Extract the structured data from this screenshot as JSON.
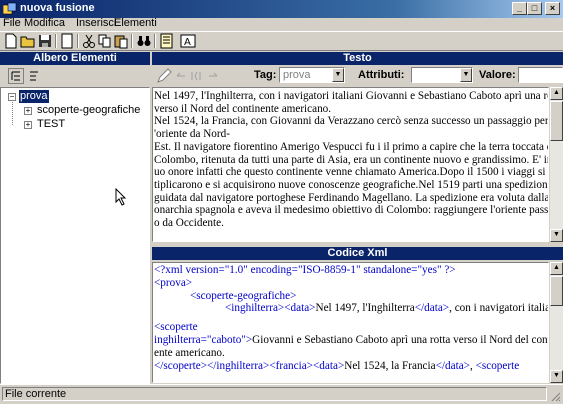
{
  "window": {
    "title": "nuova fusione"
  },
  "menu": [
    "File",
    "Modifica",
    "Inserisci",
    "Elementi"
  ],
  "left_pane": {
    "header": "Albero Elementi",
    "tree": {
      "root": "prova",
      "children": [
        "scoperte-geografiche",
        "TEST"
      ]
    }
  },
  "testo_pane": {
    "header": "Testo",
    "tag_label": "Tag:",
    "tag_value": "prova",
    "attr_label": "Attributi:",
    "value_label": "Valore:",
    "lines": [
      "Nel 1497, l'Inghilterra, con i navigatori italiani Giovanni e Sebastiano Caboto aprì una rotta",
      " verso il Nord del continente americano.",
      "Nel 1524, la Francia, con Giovanni da Verazzano cercò senza successo un passaggio per l",
      "'oriente da Nord-",
      "Est. Il navigatore fiorentino Amerigo Vespucci fu i il primo a capire che la terra toccata da",
      "Colombo, ritenuta da tutti una parte di Asia, era un continente nuovo e grandissimo. E' in s",
      "uo onore infatti che questo continente venne chiamato America.Dopo il 1500 i viaggi si mol",
      "tiplicarono e si acquisirono nuove conoscenze geografiche.Nel 1519  parti una spedizione",
      "guidata dal navigatore portoghese Ferdinando Magellano. La spedizione era voluta dalla m",
      "onarchia spagnola e aveva il medesimo obiettivo di Colombo: raggiungere l'oriente passand",
      "o da Occidente."
    ]
  },
  "xml_pane": {
    "header": "Codice Xml",
    "l1": "<?xml version=\"1.0\" encoding=\"ISO-8859-1\" standalone=\"yes\" ?>",
    "l2": "<prova>",
    "l3": "<scoperte-geografiche>",
    "l4a": "<inghilterra>",
    "l4b": "<data>",
    "l4c": "Nel 1497, l'Inghilterra",
    "l4d": "</data>",
    "l4e": ", con i navigatori italiani",
    "l5": "<scoperte",
    "l6": "inghilterra=\"caboto\">",
    "l6b": "Giovanni e Sebastiano Caboto aprì una rotta verso il Nord del contin",
    "l7": "ente americano.",
    "l8a": "</scoperte>",
    "l8b": "</inghilterra>",
    "l8c": "<francia>",
    "l8d": "<data>",
    "l8e": "Nel 1524, la Francia",
    "l8f": "</data>",
    "l8g": ", ",
    "l8h": "<scoperte"
  },
  "status": {
    "text": "File corrente"
  }
}
